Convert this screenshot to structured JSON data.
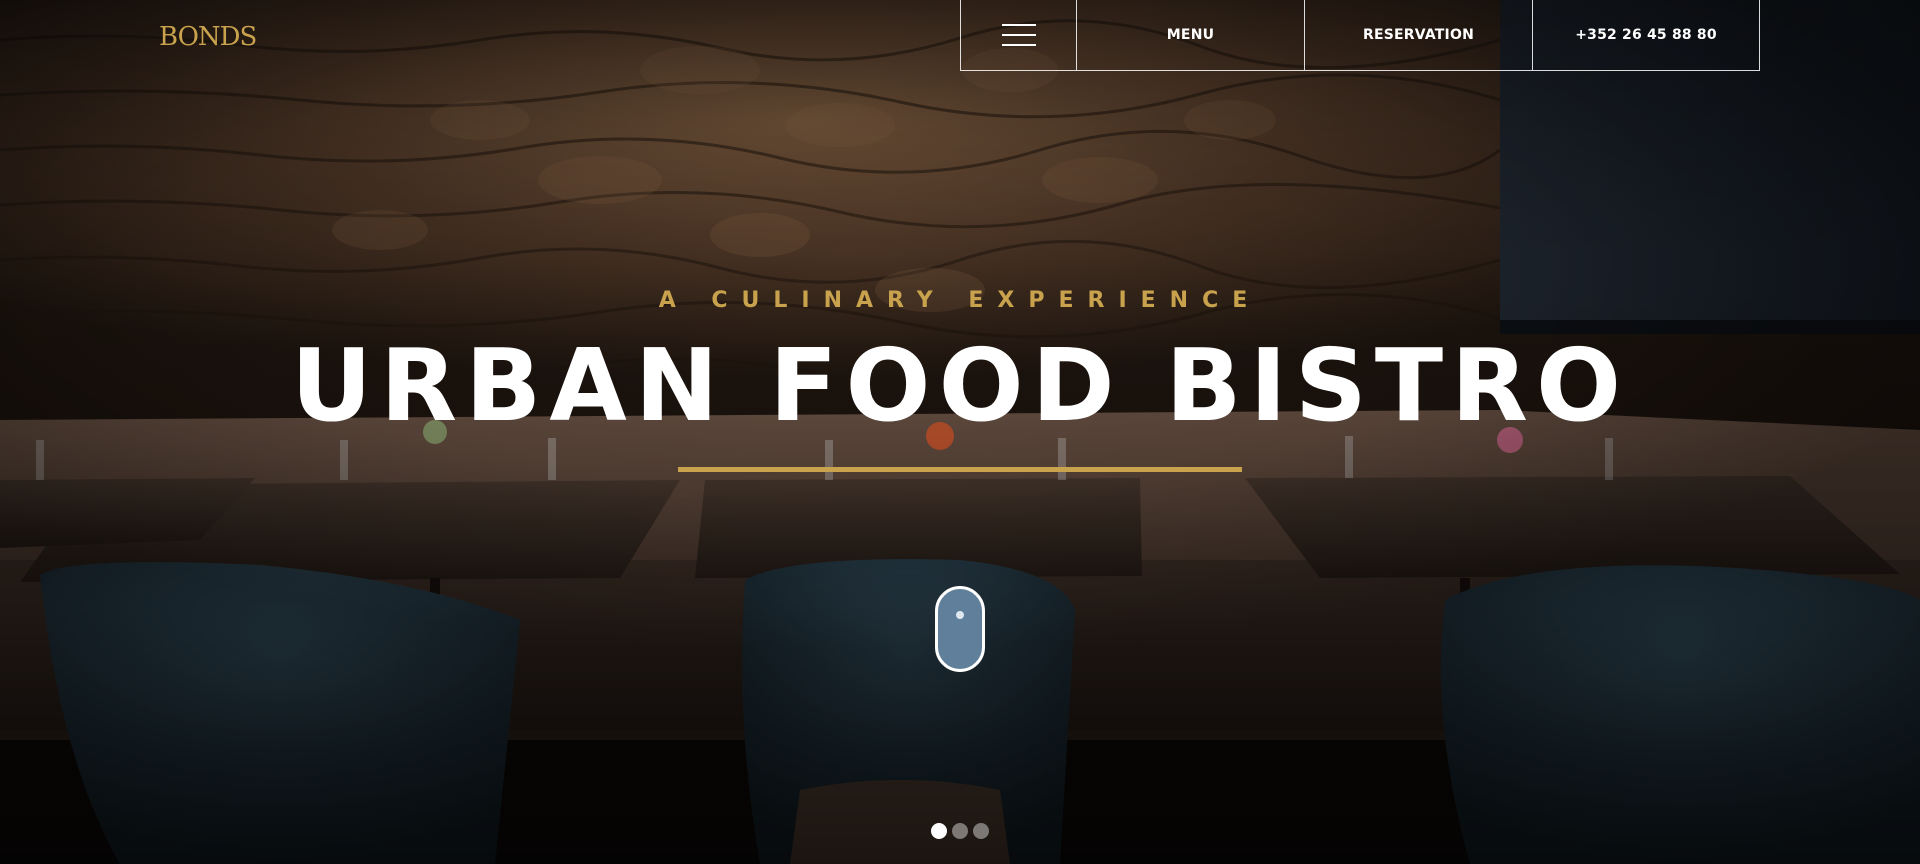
{
  "brand": {
    "logo_text": "BONDS"
  },
  "nav": {
    "menu_label": "MENU",
    "reservation_label": "RESERVATION",
    "phone": "+352 26 45 88 80"
  },
  "hero": {
    "tagline": "A CULINARY EXPERIENCE",
    "title": "URBAN FOOD BISTRO"
  },
  "slider": {
    "total_slides": 3,
    "active_slide": 1
  },
  "colors": {
    "accent_gold": "#c9a24d",
    "text_white": "#ffffff",
    "scroll_mouse_fill": "#5f7f9b"
  },
  "icons": {
    "nav_toggle": "hamburger-icon",
    "scroll_hint": "mouse-scroll-icon"
  }
}
